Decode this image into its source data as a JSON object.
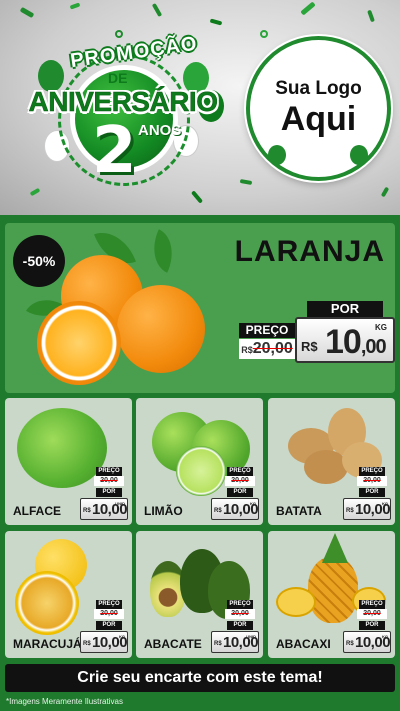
{
  "header": {
    "promo_word": "PROMOÇÃO",
    "de_word": "DE",
    "aniversario_word": "ANIVERSÁRIO",
    "number": "2",
    "anos_word": "ANOS",
    "logo_line1": "Sua Logo",
    "logo_line2": "Aqui"
  },
  "featured": {
    "discount": "-50%",
    "name": "LARANJA",
    "por_label": "POR",
    "preco_label": "PREÇO",
    "old_currency": "R$",
    "old_price": "20,00",
    "currency": "R$",
    "price_int": "10",
    "price_dec": ",00",
    "unit": "KG"
  },
  "products": [
    {
      "name": "ALFACE",
      "preco_label": "PREÇO",
      "old_price": "20,00",
      "por_label": "POR",
      "currency": "R$",
      "price": "10,00",
      "unit": "UNID"
    },
    {
      "name": "LIMÃO",
      "preco_label": "PREÇO",
      "old_price": "20,00",
      "por_label": "POR",
      "currency": "R$",
      "price": "10,00",
      "unit": "KG"
    },
    {
      "name": "BATATA",
      "preco_label": "PREÇO",
      "old_price": "20,00",
      "por_label": "POR",
      "currency": "R$",
      "price": "10,00",
      "unit": "KG"
    },
    {
      "name": "MARACUJÁ",
      "preco_label": "PREÇO",
      "old_price": "20,00",
      "por_label": "POR",
      "currency": "R$",
      "price": "10,00",
      "unit": "KG"
    },
    {
      "name": "ABACATE",
      "preco_label": "PREÇO",
      "old_price": "20,00",
      "por_label": "POR",
      "currency": "R$",
      "price": "10,00",
      "unit": "UNID"
    },
    {
      "name": "ABACAXI",
      "preco_label": "PREÇO",
      "old_price": "20,00",
      "por_label": "POR",
      "currency": "R$",
      "price": "10,00",
      "unit": "KG"
    }
  ],
  "footer": {
    "cta": "Crie seu encarte com este tema!",
    "disclaimer": "*Imagens Meramente Ilustrativas"
  },
  "colors": {
    "brand_green": "#1f7a2e",
    "card_green": "#4a9f4f",
    "card_bg": "#c9d8c9",
    "strike_red": "#e00000"
  },
  "icons": [
    "orange-image",
    "lettuce-image",
    "lime-image",
    "potato-image",
    "passion-fruit-image",
    "avocado-image",
    "pineapple-image",
    "balloon-icon",
    "confetti-decoration"
  ]
}
